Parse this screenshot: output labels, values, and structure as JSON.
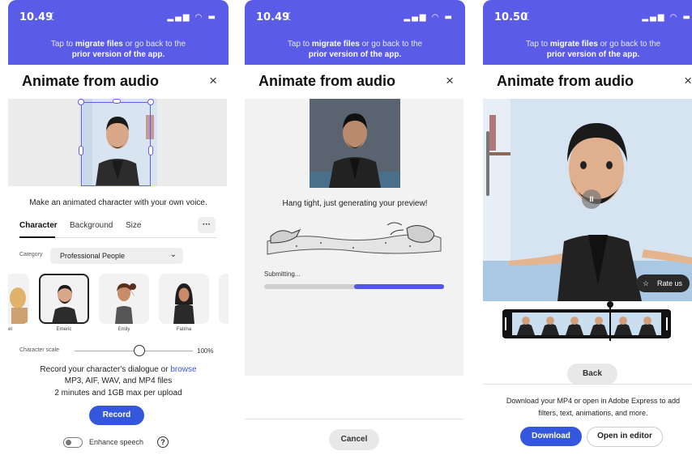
{
  "screens": [
    {
      "status_time": "10.49",
      "banner_pre": "Tap to ",
      "banner_bold": "migrate files",
      "banner_post": " or go back to the",
      "banner_line2": "prior version of the app.",
      "title": "Animate from audio",
      "close": "×",
      "subtitle": "Make an animated character with your own voice.",
      "tabs": [
        "Character",
        "Background",
        "Size"
      ],
      "more": "···",
      "category_label": "Category",
      "category_value": "Professional People",
      "characters": [
        "Emeric",
        "Emily",
        "Fatima"
      ],
      "partial_char": "et",
      "scale_label": "Character scale",
      "scale_value": "100%",
      "scale_fraction": 0.55,
      "record_text_pre": "Record your character's dialogue or ",
      "record_text_link": "browse",
      "formats": "MP3, AIF, WAV, and MP4 files",
      "limits": "2 minutes and 1GB max per upload",
      "record_button": "Record",
      "enhance_label": "Enhance speech",
      "help": "?"
    },
    {
      "status_time": "10.49",
      "banner_pre": "Tap to ",
      "banner_bold": "migrate files",
      "banner_post": " or go back to the",
      "banner_line2": "prior version of the app.",
      "title": "Animate from audio",
      "close": "×",
      "message": "Hang tight, just generating your preview!",
      "progress_label": "Submitting...",
      "progress_fraction": 0.5,
      "cancel_button": "Cancel"
    },
    {
      "status_time": "10.50",
      "banner_pre": "Tap to ",
      "banner_bold": "migrate files",
      "banner_post": " or go back to the",
      "banner_line2": "prior version of the app.",
      "title": "Animate from audio",
      "close": "×",
      "rate_label": "Rate us",
      "pause": "II",
      "back_button": "Back",
      "footer_line1": "Download your MP4 or open in Adobe Express to add",
      "footer_line2": "filters, text, animations, and more.",
      "download_button": "Download",
      "editor_button": "Open in editor"
    }
  ],
  "colors": {
    "banner": "#5a5be6",
    "accent": "#3557dd",
    "link": "#3557dd"
  }
}
